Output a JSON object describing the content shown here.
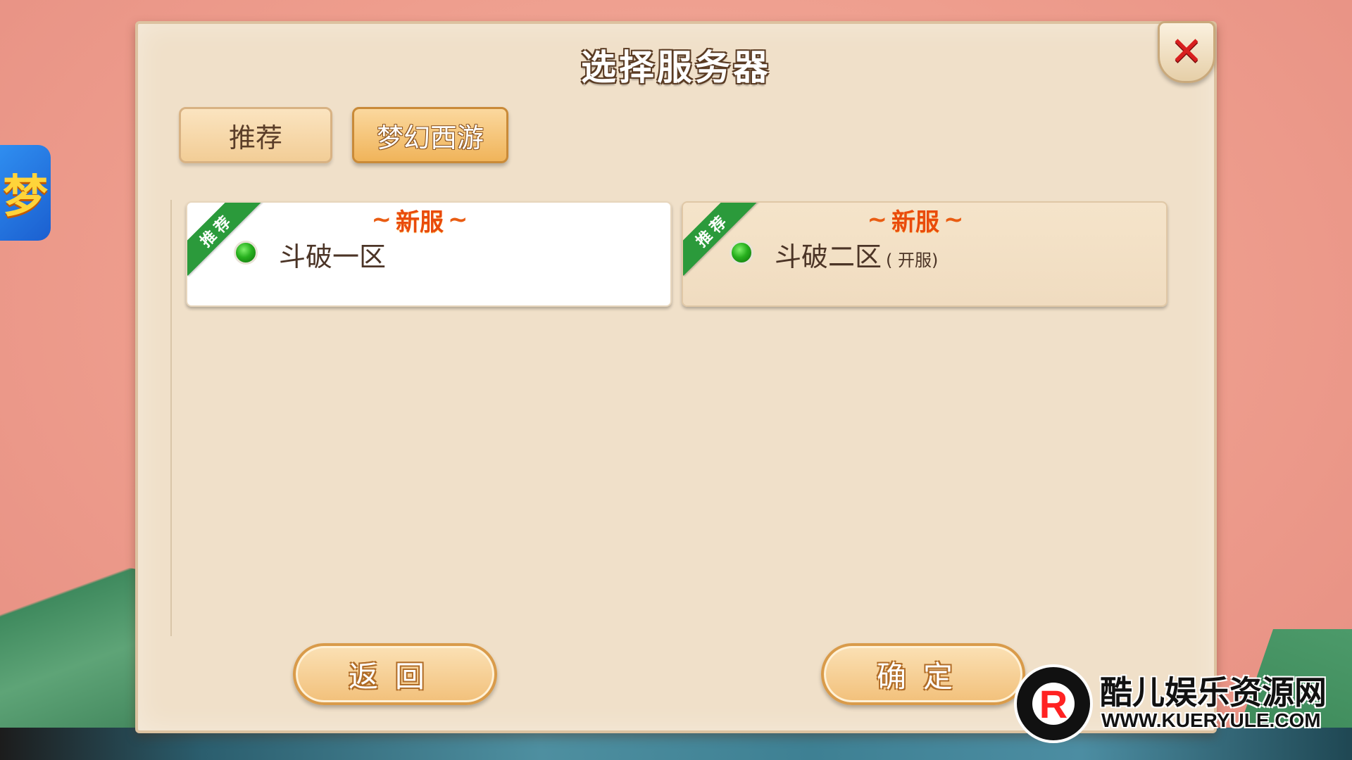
{
  "dialog": {
    "title": "选择服务器",
    "close_icon": "close-icon"
  },
  "tabs": [
    {
      "label": "推荐",
      "active": false
    },
    {
      "label": "梦幻西游",
      "active": true
    }
  ],
  "servers": [
    {
      "name": "斗破一区",
      "suffix": "",
      "badge": "新服",
      "ribbon": "推荐",
      "status_color": "#27b01e"
    },
    {
      "name": "斗破二区",
      "suffix": "( 开服)",
      "badge": "新服",
      "ribbon": "推荐",
      "status_color": "#27b01e"
    }
  ],
  "buttons": {
    "back": "返回",
    "confirm": "确定"
  },
  "side_icon": {
    "glyph": "梦"
  },
  "watermark": {
    "name": "酷儿娱乐资源网",
    "url": "WWW.KUERYULE.COM",
    "logo_letter": "R"
  },
  "colors": {
    "accent_orange": "#f0b45a",
    "ribbon_green": "#2b9a3b",
    "badge_orange": "#e94b0c",
    "close_red": "#d81f1f"
  }
}
